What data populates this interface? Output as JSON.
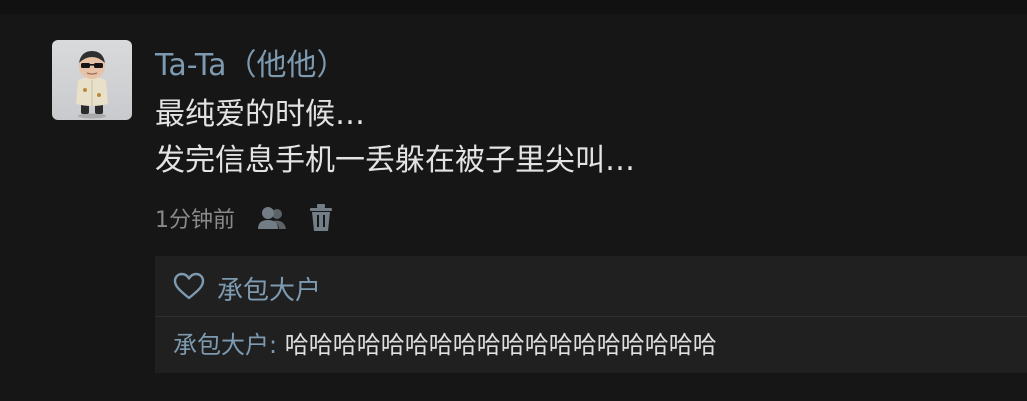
{
  "post": {
    "author": "Ta-Ta（他他）",
    "lines": [
      "最纯爱的时候…",
      "发完信息手机一丢躲在被子里尖叫…"
    ],
    "time": "1分钟前"
  },
  "icons": {
    "share": "people-icon",
    "delete": "trash-icon",
    "like": "heart-outline-icon"
  },
  "likes": {
    "names": "承包大户"
  },
  "comment": {
    "author": "承包大户: ",
    "text": "哈哈哈哈哈哈哈哈哈哈哈哈哈哈哈哈哈哈"
  },
  "colors": {
    "background": "#161616",
    "name": "#7d9ab1",
    "text": "#e3e3e3",
    "panel": "#202020"
  }
}
